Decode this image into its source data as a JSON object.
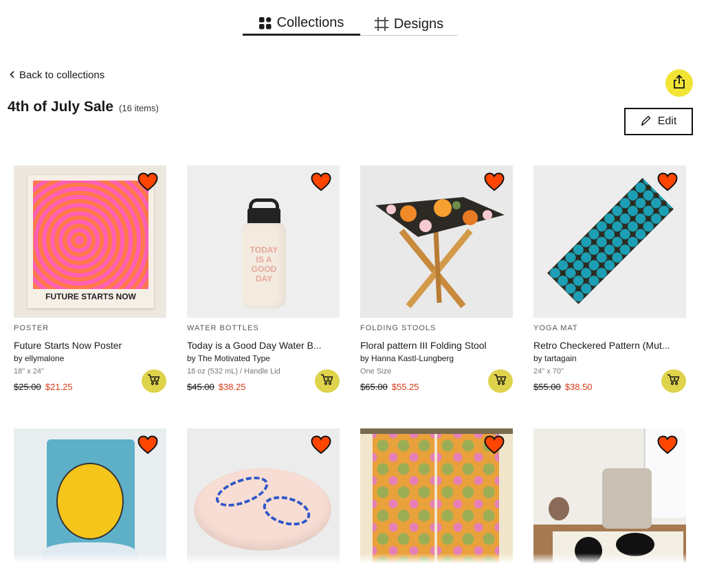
{
  "tabs": {
    "collections": "Collections",
    "designs": "Designs"
  },
  "back_label": "Back to collections",
  "collection": {
    "title": "4th of July Sale",
    "count": "(16 items)"
  },
  "edit_label": "Edit",
  "colors": {
    "accent_yellow": "#f2e435",
    "heart_red": "#ff4500",
    "sale_red": "#d93b19"
  },
  "products": [
    {
      "category": "POSTER",
      "name": "Future Starts Now Poster",
      "artist": "by ellymalone",
      "variant": "18\" x 24\"",
      "old_price": "$25.00",
      "new_price": "$21.25",
      "image_text": "FUTURE STARTS NOW"
    },
    {
      "category": "WATER BOTTLES",
      "name": "Today is a Good Day Water B...",
      "artist": "by The Motivated Type",
      "variant": "18 oz (532 mL) / Handle Lid",
      "old_price": "$45.00",
      "new_price": "$38.25",
      "image_text": "TODAY IS A GOOD DAY"
    },
    {
      "category": "FOLDING STOOLS",
      "name": "Floral pattern III Folding Stool",
      "artist": "by Hanna Kastl-Lungberg",
      "variant": "One Size",
      "old_price": "$65.00",
      "new_price": "$55.25"
    },
    {
      "category": "YOGA MAT",
      "name": "Retro Checkered Pattern (Mut...",
      "artist": "by tartagain",
      "variant": "24\" x 70\"",
      "old_price": "$55.00",
      "new_price": "$38.50"
    }
  ]
}
